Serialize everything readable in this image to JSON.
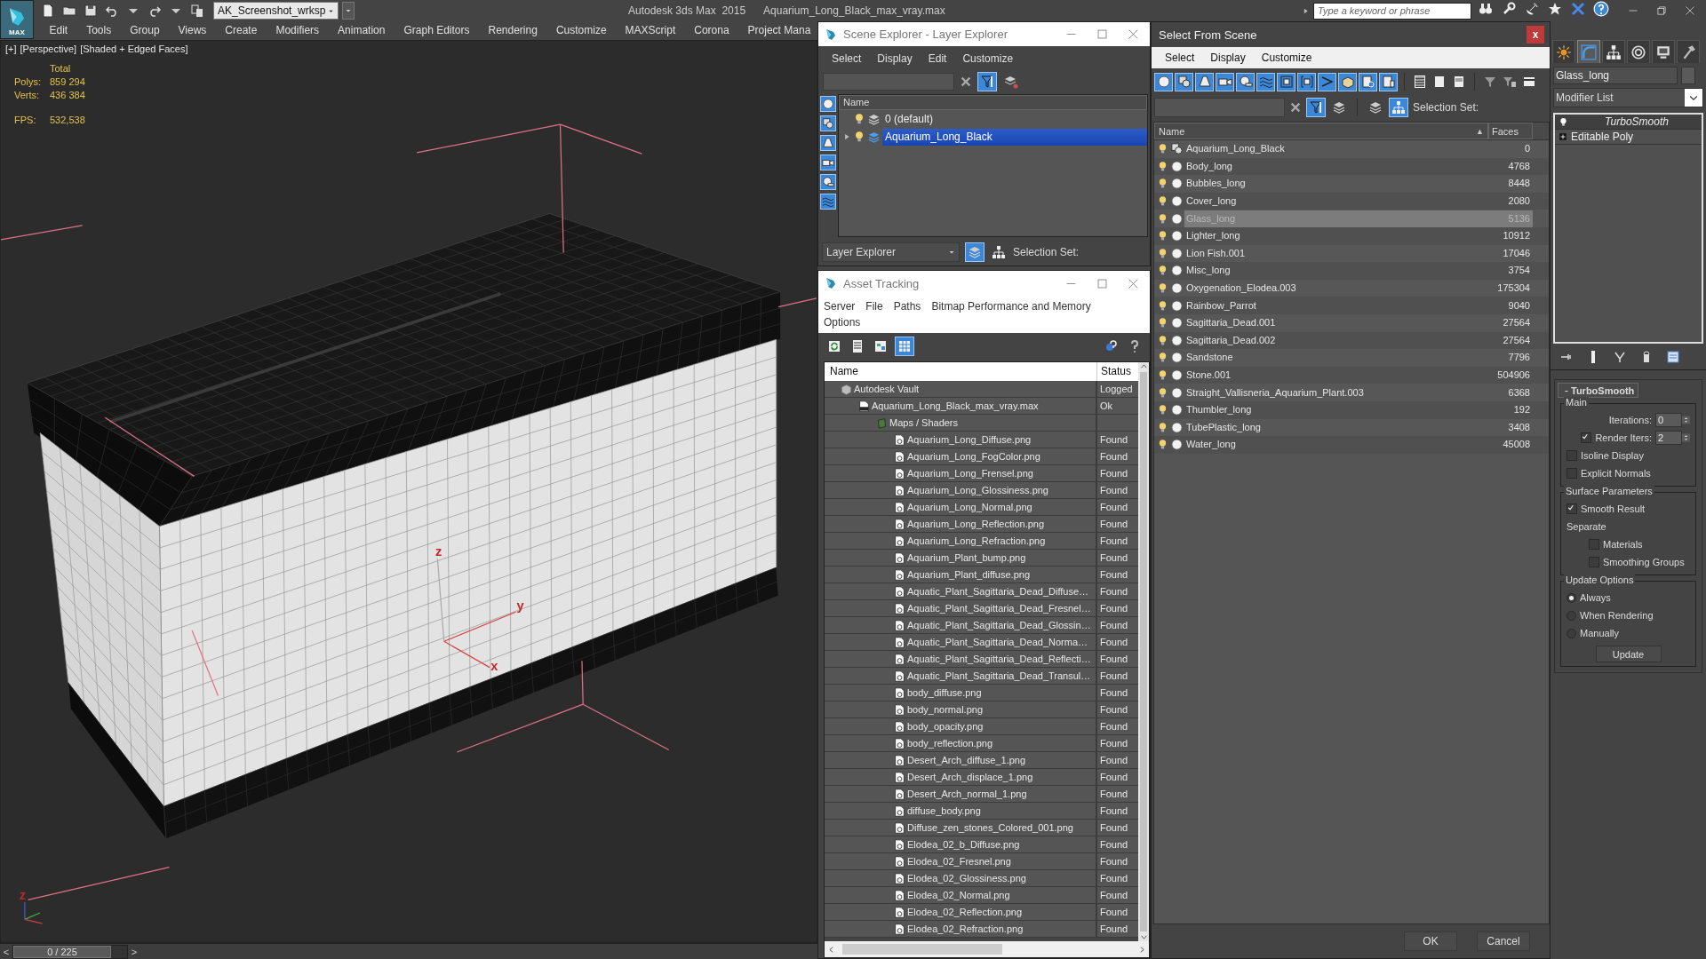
{
  "app": {
    "logo": "MAX",
    "workspace": "AK_Screenshot_wrksp",
    "title": "Autodesk 3ds Max  2015",
    "file": "Aquarium_Long_Black_max_vray.max",
    "search_placeholder": "Type a keyword or phrase"
  },
  "menu": [
    "Edit",
    "Tools",
    "Group",
    "Views",
    "Create",
    "Modifiers",
    "Animation",
    "Graph Editors",
    "Rendering",
    "Customize",
    "MAXScript",
    "Corona",
    "Project Mana"
  ],
  "viewport": {
    "labels": [
      "[+]",
      "[Perspective]",
      "[Shaded + Edged Faces]"
    ],
    "stats_header": "Total",
    "stats": [
      {
        "label": "Polys:",
        "value": "859 294"
      },
      {
        "label": "Verts:",
        "value": "436 384"
      }
    ],
    "fps": {
      "label": "FPS:",
      "value": "532,538"
    },
    "gizmo_labels": {
      "z": "z",
      "y": "y",
      "x": "x"
    },
    "corner_axis_label": "z"
  },
  "timeline": {
    "prev": "<",
    "position": "0 / 225",
    "next": ">",
    "level": 0
  },
  "scene_explorer": {
    "title": "Scene Explorer - Layer Explorer",
    "menu": [
      "Select",
      "Display",
      "Edit",
      "Customize"
    ],
    "column": "Name",
    "layers": [
      {
        "name": "0 (default)",
        "selected": false,
        "expandable": false
      },
      {
        "name": "Aquarium_Long_Black",
        "selected": true,
        "expandable": true
      }
    ],
    "mode": "Layer Explorer",
    "selection_set_label": "Selection Set:"
  },
  "asset_tracking": {
    "title": "Asset Tracking",
    "menu": [
      "Server",
      "File",
      "Paths",
      "Bitmap Performance and Memory",
      "Options"
    ],
    "columns": [
      "Name",
      "Status"
    ],
    "tree": [
      {
        "name": "Autodesk Vault",
        "status": "Logged",
        "kind": "vault",
        "children": [
          {
            "name": "Aquarium_Long_Black_max_vray.max",
            "status": "Ok",
            "kind": "scene",
            "children": [
              {
                "name": "Maps / Shaders",
                "kind": "folder",
                "children": [
                  {
                    "name": "Aquarium_Long_Diffuse.png",
                    "status": "Found",
                    "kind": "image"
                  },
                  {
                    "name": "Aquarium_Long_FogColor.png",
                    "status": "Found",
                    "kind": "image"
                  },
                  {
                    "name": "Aquarium_Long_Frensel.png",
                    "status": "Found",
                    "kind": "image"
                  },
                  {
                    "name": "Aquarium_Long_Glossiness.png",
                    "status": "Found",
                    "kind": "image"
                  },
                  {
                    "name": "Aquarium_Long_Normal.png",
                    "status": "Found",
                    "kind": "image"
                  },
                  {
                    "name": "Aquarium_Long_Reflection.png",
                    "status": "Found",
                    "kind": "image"
                  },
                  {
                    "name": "Aquarium_Long_Refraction.png",
                    "status": "Found",
                    "kind": "image"
                  },
                  {
                    "name": "Aquarium_Plant_bump.png",
                    "status": "Found",
                    "kind": "image"
                  },
                  {
                    "name": "Aquarium_Plant_diffuse.png",
                    "status": "Found",
                    "kind": "image"
                  },
                  {
                    "name": "Aquatic_Plant_Sagittaria_Dead_Diffuse…",
                    "status": "Found",
                    "kind": "image"
                  },
                  {
                    "name": "Aquatic_Plant_Sagittaria_Dead_Fresnel…",
                    "status": "Found",
                    "kind": "image"
                  },
                  {
                    "name": "Aquatic_Plant_Sagittaria_Dead_Glossin…",
                    "status": "Found",
                    "kind": "image"
                  },
                  {
                    "name": "Aquatic_Plant_Sagittaria_Dead_Norma…",
                    "status": "Found",
                    "kind": "image"
                  },
                  {
                    "name": "Aquatic_Plant_Sagittaria_Dead_Reflecti…",
                    "status": "Found",
                    "kind": "image"
                  },
                  {
                    "name": "Aquatic_Plant_Sagittaria_Dead_Transul…",
                    "status": "Found",
                    "kind": "image"
                  },
                  {
                    "name": "body_diffuse.png",
                    "status": "Found",
                    "kind": "image"
                  },
                  {
                    "name": "body_normal.png",
                    "status": "Found",
                    "kind": "image"
                  },
                  {
                    "name": "body_opacity.png",
                    "status": "Found",
                    "kind": "image"
                  },
                  {
                    "name": "body_reflection.png",
                    "status": "Found",
                    "kind": "image"
                  },
                  {
                    "name": "Desert_Arch_diffuse_1.png",
                    "status": "Found",
                    "kind": "image"
                  },
                  {
                    "name": "Desert_Arch_displace_1.png",
                    "status": "Found",
                    "kind": "image"
                  },
                  {
                    "name": "Desert_Arch_normal_1.png",
                    "status": "Found",
                    "kind": "image"
                  },
                  {
                    "name": "diffuse_body.png",
                    "status": "Found",
                    "kind": "image"
                  },
                  {
                    "name": "Diffuse_zen_stones_Colored_001.png",
                    "status": "Found",
                    "kind": "image"
                  },
                  {
                    "name": "Elodea_02_b_Diffuse.png",
                    "status": "Found",
                    "kind": "image"
                  },
                  {
                    "name": "Elodea_02_Fresnel.png",
                    "status": "Found",
                    "kind": "image"
                  },
                  {
                    "name": "Elodea_02_Glossiness.png",
                    "status": "Found",
                    "kind": "image"
                  },
                  {
                    "name": "Elodea_02_Normal.png",
                    "status": "Found",
                    "kind": "image"
                  },
                  {
                    "name": "Elodea_02_Reflection.png",
                    "status": "Found",
                    "kind": "image"
                  },
                  {
                    "name": "Elodea_02_Refraction.png",
                    "status": "Found",
                    "kind": "image"
                  }
                ]
              }
            ]
          }
        ]
      }
    ]
  },
  "select_from_scene": {
    "title": "Select From Scene",
    "close": "x",
    "menu": [
      "Select",
      "Display",
      "Customize"
    ],
    "selection_set_label": "Selection Set:",
    "sort_marker": "▲",
    "columns": [
      "Name",
      "Faces"
    ],
    "objects": [
      {
        "name": "Aquarium_Long_Black",
        "faces": "0",
        "kind": "group",
        "selected": false
      },
      {
        "name": "Body_long",
        "faces": "4768",
        "kind": "geometry",
        "selected": false
      },
      {
        "name": "Bubbles_long",
        "faces": "8448",
        "kind": "geometry",
        "selected": false
      },
      {
        "name": "Cover_long",
        "faces": "2080",
        "kind": "geometry",
        "selected": false
      },
      {
        "name": "Glass_long",
        "faces": "5136",
        "kind": "geometry",
        "selected": true
      },
      {
        "name": "Lighter_long",
        "faces": "10912",
        "kind": "geometry",
        "selected": false
      },
      {
        "name": "Lion Fish.001",
        "faces": "17046",
        "kind": "geometry",
        "selected": false
      },
      {
        "name": "Misc_long",
        "faces": "3754",
        "kind": "geometry",
        "selected": false
      },
      {
        "name": "Oxygenation_Elodea.003",
        "faces": "175304",
        "kind": "geometry",
        "selected": false
      },
      {
        "name": "Rainbow_Parrot",
        "faces": "9040",
        "kind": "geometry",
        "selected": false
      },
      {
        "name": "Sagittaria_Dead.001",
        "faces": "27564",
        "kind": "geometry",
        "selected": false
      },
      {
        "name": "Sagittaria_Dead.002",
        "faces": "27564",
        "kind": "geometry",
        "selected": false
      },
      {
        "name": "Sandstone",
        "faces": "7796",
        "kind": "geometry",
        "selected": false
      },
      {
        "name": "Stone.001",
        "faces": "504906",
        "kind": "geometry",
        "selected": false
      },
      {
        "name": "Straight_Vallisneria_Aquarium_Plant.003",
        "faces": "6368",
        "kind": "geometry",
        "selected": false
      },
      {
        "name": "Thumbler_long",
        "faces": "192",
        "kind": "geometry",
        "selected": false
      },
      {
        "name": "TubePlastic_long",
        "faces": "3408",
        "kind": "geometry",
        "selected": false
      },
      {
        "name": "Water_long",
        "faces": "45008",
        "kind": "geometry",
        "selected": false
      }
    ],
    "buttons": [
      "OK",
      "Cancel"
    ]
  },
  "command_panel": {
    "tabs": [
      {
        "selected": false
      },
      {
        "selected": true
      },
      {
        "selected": false
      },
      {
        "selected": false
      },
      {
        "selected": false
      },
      {
        "selected": false
      }
    ],
    "object_name": "Glass_long",
    "modifier_list": "Modifier List",
    "stack": [
      {
        "name": "TurboSmooth",
        "kind": "modifier"
      },
      {
        "name": "Editable Poly",
        "kind": "base"
      }
    ],
    "rollout": {
      "collapse": "-",
      "title": "TurboSmooth",
      "groups": [
        {
          "title": "Main",
          "items": [
            {
              "kind": "spinner",
              "label": "Iterations:",
              "value": "0"
            },
            {
              "kind": "check-spinner",
              "label": "Render Iters:",
              "value": "2",
              "checked": true
            },
            {
              "kind": "checkbox",
              "label": "Isoline Display",
              "checked": false
            },
            {
              "kind": "checkbox",
              "label": "Explicit Normals",
              "checked": false
            }
          ]
        },
        {
          "title": "Surface Parameters",
          "items": [
            {
              "kind": "checkbox",
              "label": "Smooth Result",
              "checked": true
            },
            {
              "kind": "label",
              "label": "Separate"
            },
            {
              "kind": "sub-checkbox",
              "label": "Materials",
              "checked": false
            },
            {
              "kind": "sub-checkbox",
              "label": "Smoothing Groups",
              "checked": false
            }
          ]
        },
        {
          "title": "Update Options",
          "items": [
            {
              "kind": "radio",
              "label": "Always",
              "selected": true
            },
            {
              "kind": "radio",
              "label": "When Rendering",
              "selected": false
            },
            {
              "kind": "radio",
              "label": "Manually",
              "selected": false
            },
            {
              "kind": "button",
              "label": "Update"
            }
          ]
        }
      ]
    }
  }
}
